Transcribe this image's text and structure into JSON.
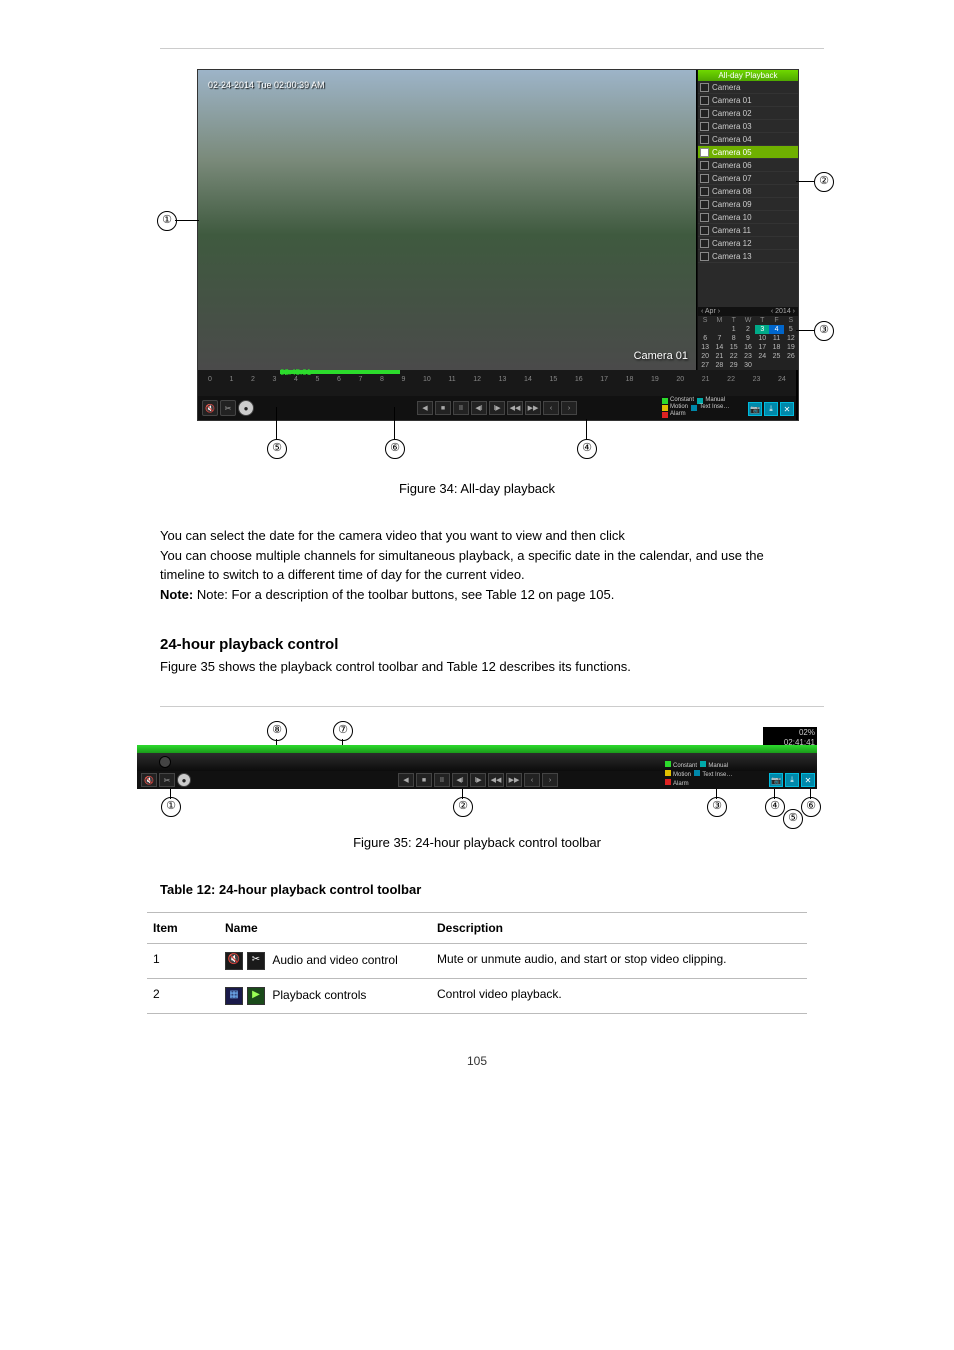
{
  "fig1": {
    "timestamp": "02-24-2014 Tue 02:00:39 AM",
    "cam_label": "Camera 01",
    "panel_title": "All-day Playback",
    "camera_header": "Camera",
    "cameras": [
      "Camera 01",
      "Camera 02",
      "Camera 03",
      "Camera 04",
      "Camera 05",
      "Camera 06",
      "Camera 07",
      "Camera 08",
      "Camera 09",
      "Camera 10",
      "Camera 11",
      "Camera 12",
      "Camera 13"
    ],
    "selected_index": 4,
    "calendar": {
      "month_left": "‹  Apr  ›",
      "year_right": "‹ 2014 ›",
      "dow": [
        "S",
        "M",
        "T",
        "W",
        "T",
        "F",
        "S"
      ],
      "days": [
        "",
        "",
        "1",
        "2",
        "3",
        "4",
        "5",
        "6",
        "7",
        "8",
        "9",
        "10",
        "11",
        "12",
        "13",
        "14",
        "15",
        "16",
        "17",
        "18",
        "19",
        "20",
        "21",
        "22",
        "23",
        "24",
        "25",
        "26",
        "27",
        "28",
        "29",
        "30",
        "",
        "",
        ""
      ],
      "today_idx": 4,
      "cur_idx": 5
    },
    "timeline_time": "02:45:01",
    "hours": [
      "0",
      "1",
      "2",
      "3",
      "4",
      "5",
      "6",
      "7",
      "8",
      "9",
      "10",
      "11",
      "12",
      "13",
      "14",
      "15",
      "16",
      "17",
      "18",
      "19",
      "20",
      "21",
      "22",
      "23",
      "24"
    ],
    "legend": {
      "constant": "Constant",
      "motion": "Motion",
      "alarm": "Alarm",
      "manual": "Manual",
      "textinse": "Text Inse…"
    }
  },
  "fig1_caption": "Figure 34: All-day playback",
  "table_ref": "Table 12 on page 105.",
  "table_instruction": "You can select the date for the camera video that you want to view and then click",
  "para1": "You can choose multiple channels for simultaneous playback, a specific date in the calendar, and use the timeline to switch to a different time of day for the current video.",
  "para2": "Note: For a description of the toolbar buttons, see ",
  "heading2": "24-hour playback control",
  "para3": "Figure 35 shows the playback control toolbar and Table 12 describes its functions.",
  "fig2_caption": "Figure 35: 24-hour playback control toolbar",
  "timebox": {
    "pct": "02%",
    "time": "02:41:41"
  },
  "table": {
    "caption": "Table 12: 24-hour playback control toolbar",
    "headers": [
      "Item",
      "Name",
      "Description"
    ],
    "rows": [
      {
        "item": "1",
        "name": "Audio and video control",
        "desc": "Mute or unmute audio, and start or stop video clipping."
      },
      {
        "item": "2",
        "name": "Playback controls",
        "desc": "Control video playback."
      }
    ]
  },
  "callout_labels": {
    "c1": "①",
    "c2": "②",
    "c3": "③",
    "c4": "④",
    "c5": "⑤",
    "c6": "⑥",
    "c7": "⑦",
    "c8": "⑧"
  },
  "footer": "105"
}
